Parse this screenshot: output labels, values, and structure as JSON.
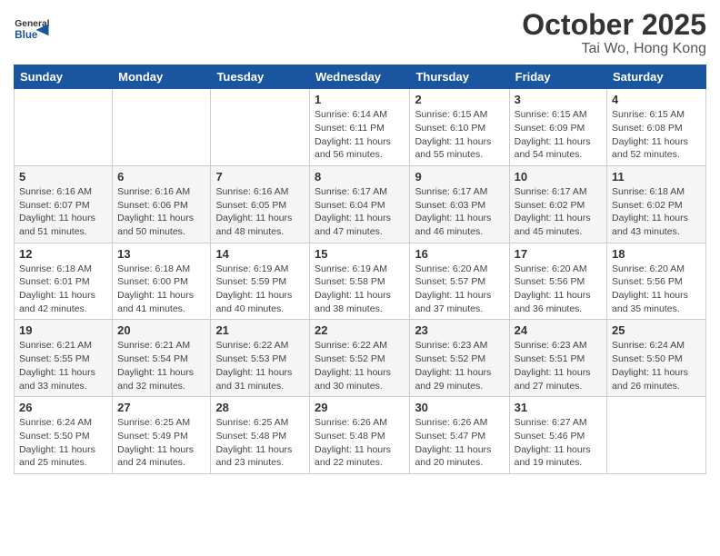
{
  "header": {
    "logo_line1": "General",
    "logo_line2": "Blue",
    "month": "October 2025",
    "location": "Tai Wo, Hong Kong"
  },
  "weekdays": [
    "Sunday",
    "Monday",
    "Tuesday",
    "Wednesday",
    "Thursday",
    "Friday",
    "Saturday"
  ],
  "weeks": [
    [
      {
        "day": "",
        "info": ""
      },
      {
        "day": "",
        "info": ""
      },
      {
        "day": "",
        "info": ""
      },
      {
        "day": "1",
        "info": "Sunrise: 6:14 AM\nSunset: 6:11 PM\nDaylight: 11 hours\nand 56 minutes."
      },
      {
        "day": "2",
        "info": "Sunrise: 6:15 AM\nSunset: 6:10 PM\nDaylight: 11 hours\nand 55 minutes."
      },
      {
        "day": "3",
        "info": "Sunrise: 6:15 AM\nSunset: 6:09 PM\nDaylight: 11 hours\nand 54 minutes."
      },
      {
        "day": "4",
        "info": "Sunrise: 6:15 AM\nSunset: 6:08 PM\nDaylight: 11 hours\nand 52 minutes."
      }
    ],
    [
      {
        "day": "5",
        "info": "Sunrise: 6:16 AM\nSunset: 6:07 PM\nDaylight: 11 hours\nand 51 minutes."
      },
      {
        "day": "6",
        "info": "Sunrise: 6:16 AM\nSunset: 6:06 PM\nDaylight: 11 hours\nand 50 minutes."
      },
      {
        "day": "7",
        "info": "Sunrise: 6:16 AM\nSunset: 6:05 PM\nDaylight: 11 hours\nand 48 minutes."
      },
      {
        "day": "8",
        "info": "Sunrise: 6:17 AM\nSunset: 6:04 PM\nDaylight: 11 hours\nand 47 minutes."
      },
      {
        "day": "9",
        "info": "Sunrise: 6:17 AM\nSunset: 6:03 PM\nDaylight: 11 hours\nand 46 minutes."
      },
      {
        "day": "10",
        "info": "Sunrise: 6:17 AM\nSunset: 6:02 PM\nDaylight: 11 hours\nand 45 minutes."
      },
      {
        "day": "11",
        "info": "Sunrise: 6:18 AM\nSunset: 6:02 PM\nDaylight: 11 hours\nand 43 minutes."
      }
    ],
    [
      {
        "day": "12",
        "info": "Sunrise: 6:18 AM\nSunset: 6:01 PM\nDaylight: 11 hours\nand 42 minutes."
      },
      {
        "day": "13",
        "info": "Sunrise: 6:18 AM\nSunset: 6:00 PM\nDaylight: 11 hours\nand 41 minutes."
      },
      {
        "day": "14",
        "info": "Sunrise: 6:19 AM\nSunset: 5:59 PM\nDaylight: 11 hours\nand 40 minutes."
      },
      {
        "day": "15",
        "info": "Sunrise: 6:19 AM\nSunset: 5:58 PM\nDaylight: 11 hours\nand 38 minutes."
      },
      {
        "day": "16",
        "info": "Sunrise: 6:20 AM\nSunset: 5:57 PM\nDaylight: 11 hours\nand 37 minutes."
      },
      {
        "day": "17",
        "info": "Sunrise: 6:20 AM\nSunset: 5:56 PM\nDaylight: 11 hours\nand 36 minutes."
      },
      {
        "day": "18",
        "info": "Sunrise: 6:20 AM\nSunset: 5:56 PM\nDaylight: 11 hours\nand 35 minutes."
      }
    ],
    [
      {
        "day": "19",
        "info": "Sunrise: 6:21 AM\nSunset: 5:55 PM\nDaylight: 11 hours\nand 33 minutes."
      },
      {
        "day": "20",
        "info": "Sunrise: 6:21 AM\nSunset: 5:54 PM\nDaylight: 11 hours\nand 32 minutes."
      },
      {
        "day": "21",
        "info": "Sunrise: 6:22 AM\nSunset: 5:53 PM\nDaylight: 11 hours\nand 31 minutes."
      },
      {
        "day": "22",
        "info": "Sunrise: 6:22 AM\nSunset: 5:52 PM\nDaylight: 11 hours\nand 30 minutes."
      },
      {
        "day": "23",
        "info": "Sunrise: 6:23 AM\nSunset: 5:52 PM\nDaylight: 11 hours\nand 29 minutes."
      },
      {
        "day": "24",
        "info": "Sunrise: 6:23 AM\nSunset: 5:51 PM\nDaylight: 11 hours\nand 27 minutes."
      },
      {
        "day": "25",
        "info": "Sunrise: 6:24 AM\nSunset: 5:50 PM\nDaylight: 11 hours\nand 26 minutes."
      }
    ],
    [
      {
        "day": "26",
        "info": "Sunrise: 6:24 AM\nSunset: 5:50 PM\nDaylight: 11 hours\nand 25 minutes."
      },
      {
        "day": "27",
        "info": "Sunrise: 6:25 AM\nSunset: 5:49 PM\nDaylight: 11 hours\nand 24 minutes."
      },
      {
        "day": "28",
        "info": "Sunrise: 6:25 AM\nSunset: 5:48 PM\nDaylight: 11 hours\nand 23 minutes."
      },
      {
        "day": "29",
        "info": "Sunrise: 6:26 AM\nSunset: 5:48 PM\nDaylight: 11 hours\nand 22 minutes."
      },
      {
        "day": "30",
        "info": "Sunrise: 6:26 AM\nSunset: 5:47 PM\nDaylight: 11 hours\nand 20 minutes."
      },
      {
        "day": "31",
        "info": "Sunrise: 6:27 AM\nSunset: 5:46 PM\nDaylight: 11 hours\nand 19 minutes."
      },
      {
        "day": "",
        "info": ""
      }
    ]
  ]
}
